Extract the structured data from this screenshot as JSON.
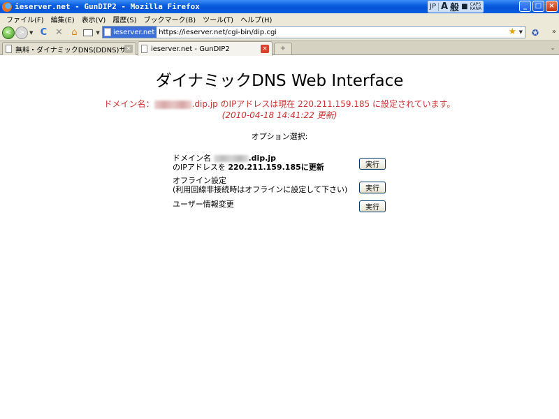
{
  "window": {
    "title": "ieserver.net - GunDIP2 - Mozilla Firefox",
    "ime": {
      "lang": "JP",
      "mode_main": "A",
      "mode_sub": "般",
      "caps": "CAPS",
      "kana": "KANA"
    },
    "buttons": {
      "minimize": "_",
      "maximize": "□",
      "close": "×"
    }
  },
  "menubar": {
    "items": [
      "ファイル(F)",
      "編集(E)",
      "表示(V)",
      "履歴(S)",
      "ブックマーク(B)",
      "ツール(T)",
      "ヘルプ(H)"
    ]
  },
  "navbar": {
    "site_identity": "ieserver.net",
    "url": "https://ieserver.net/cgi-bin/dip.cgi",
    "bookmark_star": "★",
    "reload_glyph": "C",
    "stop_glyph": "✕",
    "home_glyph": "⌂",
    "back_glyph": "<",
    "forward_glyph": ">",
    "overflow_glyph": "»"
  },
  "tabs": [
    {
      "label": "無料・ダイナミックDNS(DDNS)サービス -...",
      "active": false,
      "close": "×"
    },
    {
      "label": "ieserver.net - GunDIP2",
      "active": true,
      "close": "×"
    }
  ],
  "tabbar": {
    "new_tab": "+",
    "list_arrow": "⌄"
  },
  "page": {
    "heading": "ダイナミックDNS Web Interface",
    "status_prefix": "ドメイン名：",
    "status_suffix": ".dip.jp のIPアドレスは現在 220.211.159.185 に設定されています。",
    "updated": "(2010-04-18 14:41:22 更新)",
    "options_heading": "オプション選択:",
    "options": [
      {
        "line1_prefix": "ドメイン名",
        "line1_suffix": ".dip.jp",
        "line2_prefix": "のIPアドレスを ",
        "line2_ip": "220.211.159.185",
        "line2_suffix": "に更新",
        "button": "実行"
      },
      {
        "line1": "オフライン設定",
        "line2": "(利用回線非接続時はオフラインに設定して下さい)",
        "button": "実行"
      },
      {
        "line1": "ユーザー情報変更",
        "button": "実行"
      }
    ]
  }
}
